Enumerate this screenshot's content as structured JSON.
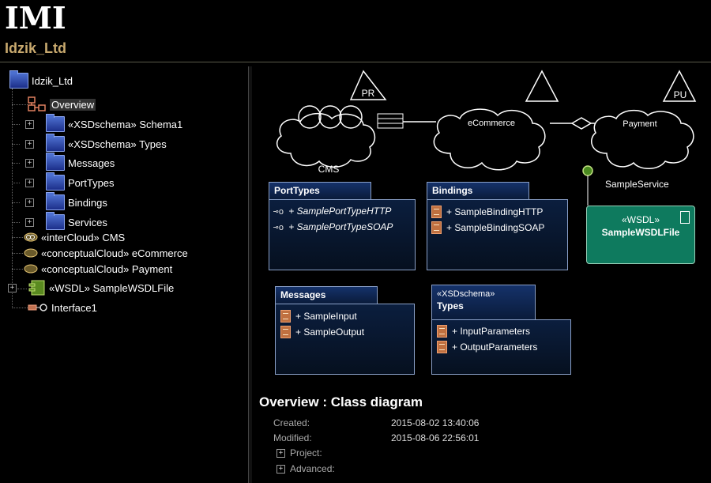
{
  "header": {
    "logo_text": "IMI",
    "title": "Idzik_Ltd"
  },
  "tree": {
    "root": "Idzik_Ltd",
    "items": [
      {
        "label": "Overview",
        "selected": true,
        "icon": "class-diagram-icon"
      },
      {
        "label": "«XSDschema» Schema1",
        "icon": "package-icon",
        "expandable": true
      },
      {
        "label": "«XSDschema» Types",
        "icon": "package-icon",
        "expandable": true
      },
      {
        "label": "Messages",
        "icon": "package-icon",
        "expandable": true
      },
      {
        "label": "PortTypes",
        "icon": "package-icon",
        "expandable": true
      },
      {
        "label": "Bindings",
        "icon": "package-icon",
        "expandable": true
      },
      {
        "label": "Services",
        "icon": "package-icon",
        "expandable": true
      },
      {
        "label": "«interCloud» CMS",
        "icon": "intercloud-icon"
      },
      {
        "label": "«conceptualCloud» eCommerce",
        "icon": "cloud-icon"
      },
      {
        "label": "«conceptualCloud» Payment",
        "icon": "cloud-icon"
      },
      {
        "label": "«WSDL» SampleWSDLFile",
        "icon": "component-icon",
        "expandable": true
      },
      {
        "label": "Interface1",
        "icon": "interface-icon"
      }
    ]
  },
  "diagram": {
    "clouds": {
      "cms": {
        "label": "CMS",
        "tag": "PR"
      },
      "ecommerce": {
        "label": "eCommerce"
      },
      "payment": {
        "label": "Payment",
        "tag": "PU"
      }
    },
    "sample_service_label": "SampleService",
    "porttypes": {
      "title": "PortTypes",
      "items": [
        "+ SamplePortTypeHTTP",
        "+ SamplePortTypeSOAP"
      ]
    },
    "bindings": {
      "title": "Bindings",
      "items": [
        "+ SampleBindingHTTP",
        "+ SampleBindingSOAP"
      ]
    },
    "wsdl": {
      "stereotype": "«WSDL»",
      "name": "SampleWSDLFile"
    },
    "messages": {
      "title": "Messages",
      "items": [
        "+ SampleInput",
        "+ SampleOutput"
      ]
    },
    "types": {
      "stereotype": "«XSDschema»",
      "title": "Types",
      "items": [
        "+ InputParameters",
        "+ OutputParameters"
      ]
    }
  },
  "overview": {
    "title": "Overview : Class diagram",
    "created_label": "Created:",
    "created_value": "2015-08-02 13:40:06",
    "modified_label": "Modified:",
    "modified_value": "2015-08-06 22:56:01",
    "project_label": "Project:",
    "advanced_label": "Advanced:"
  },
  "colors": {
    "accent": "#c8a96e",
    "box_border": "#8aa0c8",
    "wsdl_fill": "#0e7a5e",
    "background": "#000000"
  }
}
